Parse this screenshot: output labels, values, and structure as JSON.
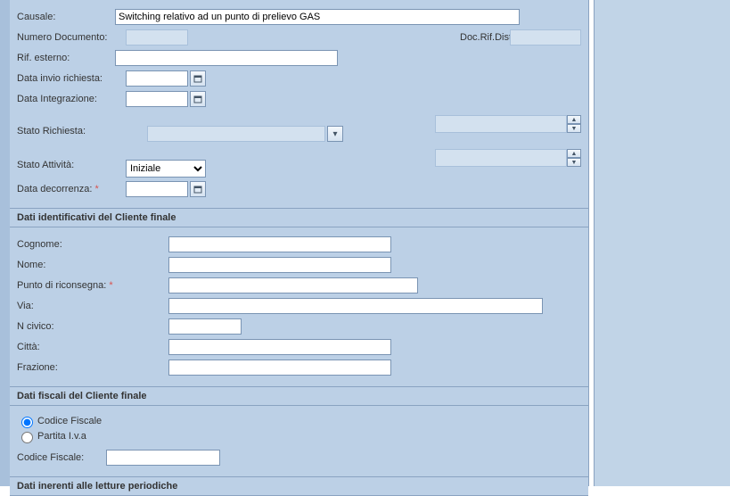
{
  "top": {
    "causale_label": "Causale:",
    "causale_value": "Switching relativo ad un punto di prelievo GAS",
    "numdoc_label": "Numero Documento:",
    "numdoc_value": "",
    "docrif_label": "Doc.Rif.Distr.:",
    "docrif_value": "",
    "rif_esterno_label": "Rif. esterno:",
    "rif_esterno_value": "",
    "data_invio_label": "Data invio richiesta:",
    "data_invio_value": "",
    "data_integr_label": "Data Integrazione:",
    "data_integr_value": "",
    "stato_richiesta_label": "Stato Richiesta:",
    "stato_richiesta_value": "",
    "stato_attivita_label": "Stato Attività:",
    "stato_attivita_value": "Iniziale",
    "stato_attivita_options": [
      "Iniziale"
    ],
    "data_decorr_label": "Data decorrenza:",
    "data_decorr_req": "*",
    "data_decorr_value": "",
    "multibox1_value": "",
    "multibox2_value": ""
  },
  "section1_title": "Dati identificativi del Cliente finale",
  "client": {
    "cognome_label": "Cognome:",
    "cognome_value": "",
    "nome_label": "Nome:",
    "nome_value": "",
    "punto_label": "Punto di riconsegna:",
    "punto_req": "*",
    "punto_value": "",
    "via_label": "Via:",
    "via_value": "",
    "ncivico_label": "N civico:",
    "ncivico_value": "",
    "citta_label": "Città:",
    "citta_value": "",
    "frazione_label": "Frazione:",
    "frazione_value": ""
  },
  "section2_title": "Dati fiscali del Cliente finale",
  "fiscal": {
    "cf_radio_label": "Codice Fiscale",
    "piva_radio_label": "Partita I.v.a",
    "selected": "cf",
    "cf_field_label": "Codice Fiscale:",
    "cf_field_value": ""
  },
  "section3_title": "Dati inerenti alle letture periodiche"
}
